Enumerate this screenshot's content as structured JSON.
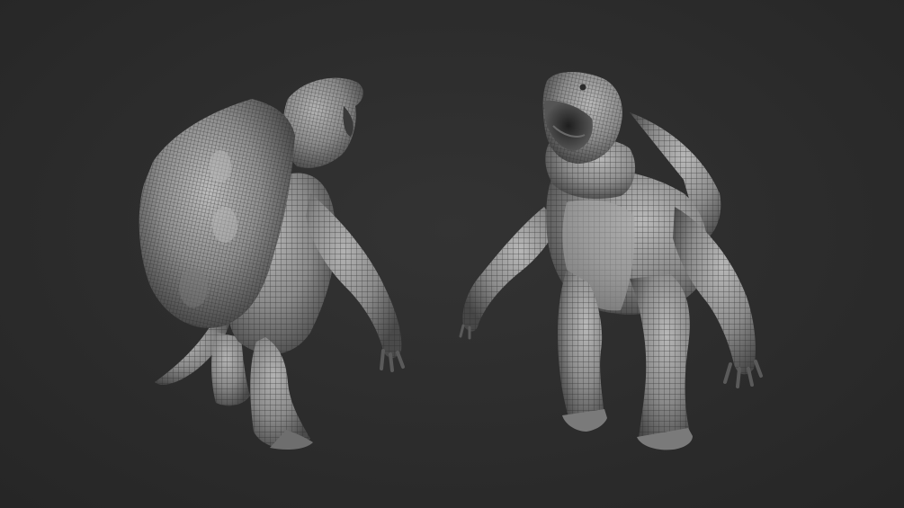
{
  "scene": {
    "background_color": "#2c2c2c",
    "material_color": "#9a9a9a",
    "wireframe_color": "#2a2a2a",
    "views": [
      {
        "name": "creature-back-three-quarter-view"
      },
      {
        "name": "creature-front-three-quarter-view"
      }
    ]
  }
}
